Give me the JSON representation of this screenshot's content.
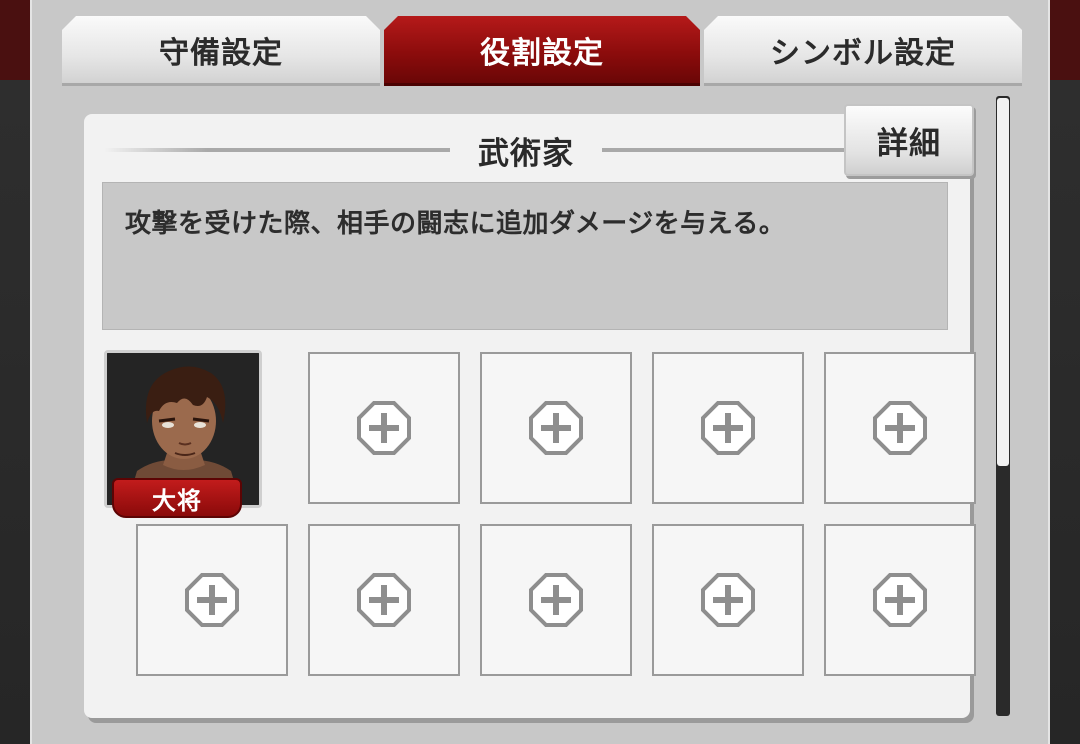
{
  "tabs": [
    {
      "label": "守備設定",
      "active": false
    },
    {
      "label": "役割設定",
      "active": true
    },
    {
      "label": "シンボル設定",
      "active": false
    }
  ],
  "role": {
    "title": "武術家",
    "detail_label": "詳細",
    "description": "攻撃を受けた際、相手の闘志に追加ダメージを与える。"
  },
  "slots": {
    "leader_badge": "大将",
    "empty_icon": "plus-icon",
    "total": 10,
    "filled": 1
  },
  "colors": {
    "accent": "#8c0c0c",
    "panel": "#c8c8c8",
    "card": "#f2f2f2"
  }
}
